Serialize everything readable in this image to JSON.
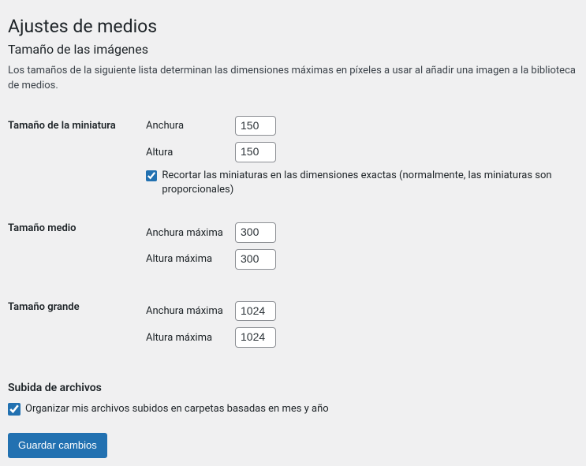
{
  "page": {
    "title": "Ajustes de medios",
    "subtitle": "Tamaño de las imágenes",
    "description": "Los tamaños de la siguiente lista determinan las dimensiones máximas en píxeles a usar al añadir una imagen a la biblioteca de medios."
  },
  "thumbnail": {
    "heading": "Tamaño de la miniatura",
    "width_label": "Anchura",
    "width_value": "150",
    "height_label": "Altura",
    "height_value": "150",
    "crop_label": "Recortar las miniaturas en las dimensiones exactas (normalmente, las miniaturas son proporcionales)",
    "crop_checked": true
  },
  "medium": {
    "heading": "Tamaño medio",
    "width_label": "Anchura máxima",
    "width_value": "300",
    "height_label": "Altura máxima",
    "height_value": "300"
  },
  "large": {
    "heading": "Tamaño grande",
    "width_label": "Anchura máxima",
    "width_value": "1024",
    "height_label": "Altura máxima",
    "height_value": "1024"
  },
  "uploads": {
    "heading": "Subida de archivos",
    "organize_label": "Organizar mis archivos subidos en carpetas basadas en mes y año",
    "organize_checked": true
  },
  "submit": {
    "label": "Guardar cambios"
  }
}
